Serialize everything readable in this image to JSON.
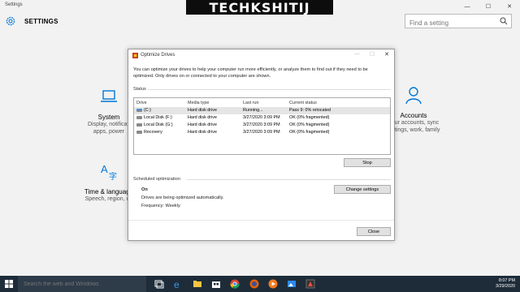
{
  "settings": {
    "window_title": "Settings",
    "header_label": "SETTINGS",
    "search_placeholder": "Find a setting",
    "tiles": [
      {
        "title": "System",
        "desc1": "Display, notificati",
        "desc2": "apps, power"
      },
      {
        "title": "Accounts",
        "desc1": "Your accounts, sync",
        "desc2": "settings, work, family"
      },
      {
        "title": "Time & language",
        "desc1": "Speech, region, da",
        "desc2": ""
      }
    ]
  },
  "watermark": "TECHKSHITIJ",
  "dialog": {
    "title": "Optimize Drives",
    "intro": "You can optimize your drives to help your computer run more efficiently, or analyze them to find out if they need to be optimized. Only drives on or connected to your computer are shown.",
    "status_label": "Status",
    "columns": [
      "Drive",
      "Media type",
      "Last run",
      "Current status"
    ],
    "drives": [
      {
        "drive": "(C:)",
        "media": "Hard disk drive",
        "last_run": "Running...",
        "status": "Pass 9: 0% relocated"
      },
      {
        "drive": "Local Disk (F:)",
        "media": "Hard disk drive",
        "last_run": "3/27/2020 3:09 PM",
        "status": "OK (0% fragmented)"
      },
      {
        "drive": "Local Disk (G:)",
        "media": "Hard disk drive",
        "last_run": "3/27/2020 3:09 PM",
        "status": "OK (0% fragmented)"
      },
      {
        "drive": "Recovery",
        "media": "Hard disk drive",
        "last_run": "3/27/2020 3:09 PM",
        "status": "OK (0% fragmented)"
      }
    ],
    "stop_label": "Stop",
    "scheduled_label": "Scheduled optimization",
    "schedule_state": "On",
    "schedule_desc": "Drives are being optimized automatically.",
    "frequency": "Frequency: Weekly",
    "change_settings_label": "Change settings",
    "close_label": "Close"
  },
  "taskbar": {
    "search_placeholder": "Search the web and Windows",
    "time": "8:07 PM",
    "date": "3/29/2020"
  },
  "colors": {
    "accent": "#0078d7",
    "taskbar": "#1e2c3a"
  }
}
